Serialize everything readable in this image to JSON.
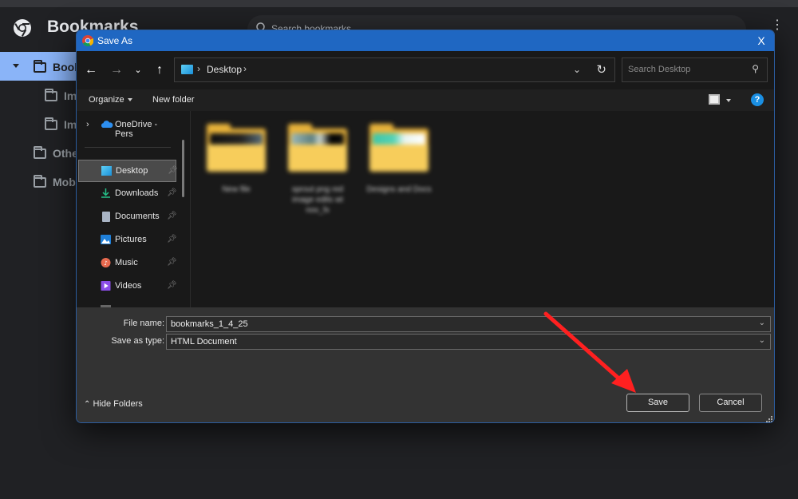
{
  "background_app": {
    "title": "Bookmarks",
    "search_placeholder": "Search bookmarks",
    "tree": [
      {
        "label": "Bookmarks bar",
        "visible_text": "Book",
        "selected": true,
        "expanded": true
      },
      {
        "label": "Im",
        "selected": false
      },
      {
        "label": "Im",
        "selected": false
      },
      {
        "label": "Othe",
        "selected": false
      },
      {
        "label": "Mobi",
        "selected": false
      }
    ]
  },
  "dialog": {
    "title": "Save As",
    "close_label": "X",
    "address": {
      "location": "Desktop",
      "separator": "›"
    },
    "search_placeholder": "Search Desktop",
    "commands": {
      "organize": "Organize",
      "new_folder": "New folder"
    },
    "help_label": "?",
    "nav_pane": {
      "onedrive": "OneDrive - Pers",
      "items": [
        {
          "label": "Desktop",
          "icon": "desktop-icon",
          "pinned": true,
          "selected": true
        },
        {
          "label": "Downloads",
          "icon": "download-icon",
          "pinned": true,
          "selected": false
        },
        {
          "label": "Documents",
          "icon": "document-icon",
          "pinned": true,
          "selected": false
        },
        {
          "label": "Pictures",
          "icon": "pictures-icon",
          "pinned": true,
          "selected": false
        },
        {
          "label": "Music",
          "icon": "music-icon",
          "pinned": true,
          "selected": false
        },
        {
          "label": "Videos",
          "icon": "videos-icon",
          "pinned": true,
          "selected": false
        }
      ]
    },
    "files": [
      {
        "name": "New file",
        "blurred": true,
        "preview": "dark"
      },
      {
        "name": "sprout png red image edits wt nov_fx",
        "blurred": true,
        "preview": "image"
      },
      {
        "name": "Designs and Docs",
        "blurred": true,
        "preview": "light"
      }
    ],
    "file_name_label": "File name:",
    "file_name_value": "bookmarks_1_4_25",
    "save_type_label": "Save as type:",
    "save_type_value": "HTML Document",
    "hide_folders_label": "Hide Folders",
    "save_label": "Save",
    "cancel_label": "Cancel"
  },
  "annotation": {
    "type": "arrow",
    "color": "#ff2020",
    "points_to": "save-button"
  }
}
